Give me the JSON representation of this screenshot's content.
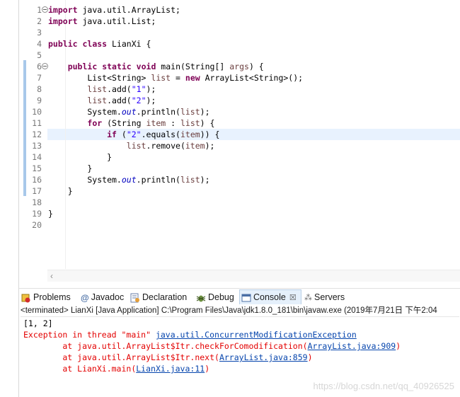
{
  "editor": {
    "line_numbers": [
      "1",
      "2",
      "3",
      "4",
      "5",
      "6",
      "7",
      "8",
      "9",
      "10",
      "11",
      "12",
      "13",
      "14",
      "15",
      "16",
      "17",
      "18",
      "19",
      "20"
    ],
    "code": [
      {
        "p1": "",
        "kw1": "import",
        "p2": " java.util.ArrayList;"
      },
      {
        "p1": "",
        "kw1": "import",
        "p2": " java.util.List;"
      },
      {
        "p1": ""
      },
      {
        "p1": "",
        "kw1": "public",
        "p2": " ",
        "kw2": "class",
        "p3": " LianXi {"
      },
      {
        "p1": ""
      },
      {
        "p1": "    ",
        "kw1": "public",
        "p2": " ",
        "kw2": "static",
        "p3": " ",
        "kw3": "void",
        "p4": " main(String[] ",
        "var1": "args",
        "p5": ") {"
      },
      {
        "p1": "        List<String> ",
        "var1": "list",
        "p2": " = ",
        "kw1": "new",
        "p3": " ArrayList<String>();"
      },
      {
        "p1": "        ",
        "var1": "list",
        "p2": ".add(",
        "str1": "\"1\"",
        "p3": ");"
      },
      {
        "p1": "        ",
        "var1": "list",
        "p2": ".add(",
        "str1": "\"2\"",
        "p3": ");"
      },
      {
        "p1": "        System.",
        "fld1": "out",
        "p2": ".println(",
        "var1": "list",
        "p3": ");"
      },
      {
        "p1": "        ",
        "kw1": "for",
        "p2": " (String ",
        "var1": "item",
        "p3": " : ",
        "var2": "list",
        "p4": ") {"
      },
      {
        "p1": "            ",
        "kw1": "if",
        "p2": " (",
        "str1": "\"2\"",
        "p3": ".equals(",
        "var1": "item",
        "p4": ")) {"
      },
      {
        "p1": "                ",
        "var1": "list",
        "p2": ".remove(",
        "var2": "item",
        "p3": ");"
      },
      {
        "p1": "            }"
      },
      {
        "p1": "        }"
      },
      {
        "p1": "        System.",
        "fld1": "out",
        "p2": ".println(",
        "var1": "list",
        "p3": ");"
      },
      {
        "p1": "    }"
      },
      {
        "p1": ""
      },
      {
        "p1": "}"
      },
      {
        "p1": ""
      }
    ]
  },
  "tabs": [
    {
      "label": "Problems",
      "icon": "problems-icon"
    },
    {
      "label": "Javadoc",
      "icon": "javadoc-icon"
    },
    {
      "label": "Declaration",
      "icon": "declaration-icon"
    },
    {
      "label": "Debug",
      "icon": "debug-icon"
    },
    {
      "label": "Console",
      "icon": "console-icon"
    },
    {
      "label": "Servers",
      "icon": "servers-icon"
    }
  ],
  "console": {
    "terminated": "<terminated> LianXi [Java Application] C:\\Program Files\\Java\\jdk1.8.0_181\\bin\\javaw.exe (2019年7月21日 下午2:04",
    "output_line": "[1, 2]",
    "exception_prefix": "Exception in thread \"main\" ",
    "exception_class": "java.util.ConcurrentModificationException",
    "trace": [
      {
        "prefix": "\tat java.util.ArrayList$Itr.checkForComodification(",
        "link": "ArrayList.java:909",
        "suffix": ")"
      },
      {
        "prefix": "\tat java.util.ArrayList$Itr.next(",
        "link": "ArrayList.java:859",
        "suffix": ")"
      },
      {
        "prefix": "\tat LianXi.main(",
        "link": "LianXi.java:11",
        "suffix": ")"
      }
    ],
    "watermark": "https://blog.csdn.net/qq_40926525"
  },
  "colors": {
    "keyword": "#7f0055",
    "string": "#2a00ff",
    "field": "#0000c0",
    "error": "#e30000",
    "link": "#0645ad",
    "current_line": "#e8f2fe"
  }
}
